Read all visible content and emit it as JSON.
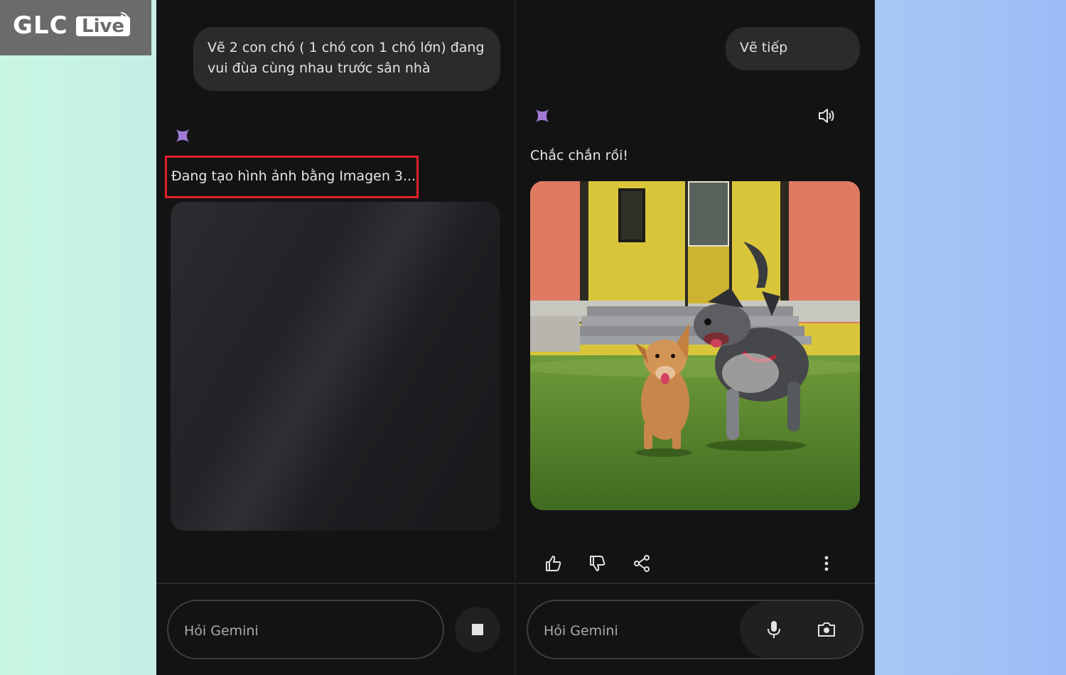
{
  "watermark": {
    "brand": "GLC",
    "badge": "Live"
  },
  "left_panel": {
    "user_prompt": "Vẽ 2 con chó ( 1 chó con 1 chó lớn) đang vui đùa cùng nhau trước sân nhà",
    "status": "Đang tạo hình ảnh bằng Imagen 3...",
    "input_placeholder": "Hỏi Gemini",
    "highlight_color": "#e0212b"
  },
  "right_panel": {
    "user_prompt": "Vẽ tiếp",
    "reply": "Chắc chắn rồi!",
    "input_placeholder": "Hỏi Gemini"
  },
  "icons": {
    "gemini": "gemini-sparkle-icon",
    "speaker": "speaker-icon",
    "like": "thumbs-up-icon",
    "dislike": "thumbs-down-icon",
    "share": "share-icon",
    "more": "more-vertical-icon",
    "stop": "stop-icon",
    "mic": "microphone-icon",
    "camera": "camera-icon"
  },
  "colors": {
    "panel_bg": "#131314",
    "bubble_bg": "#2a2b2d",
    "sparkle": "#a07bd6"
  }
}
